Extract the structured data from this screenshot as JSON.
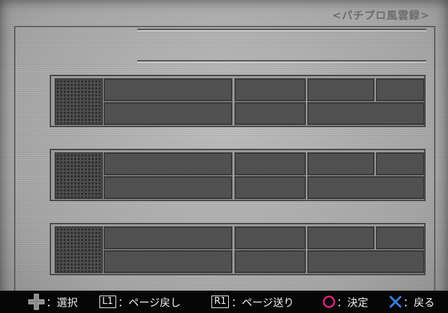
{
  "screen": {
    "title": "<パチプロ風雲録>"
  },
  "entries": [
    {
      "id": 1
    },
    {
      "id": 2
    },
    {
      "id": 3
    }
  ],
  "footer": {
    "select_label": "：選択",
    "l1_label": "L1",
    "page_back_label": "：ページ戻し",
    "r1_label": "R1",
    "page_forward_label": "：ページ送り",
    "confirm_label": "：決定",
    "back_label": "：戻る"
  },
  "colors": {
    "circle_button": "#e0248a",
    "cross_button": "#3a7de0",
    "footer_bg": "#060606",
    "panel_bg": "#b0b0b0"
  },
  "icons": [
    "dpad-icon",
    "circle-button-icon",
    "cross-button-icon"
  ]
}
